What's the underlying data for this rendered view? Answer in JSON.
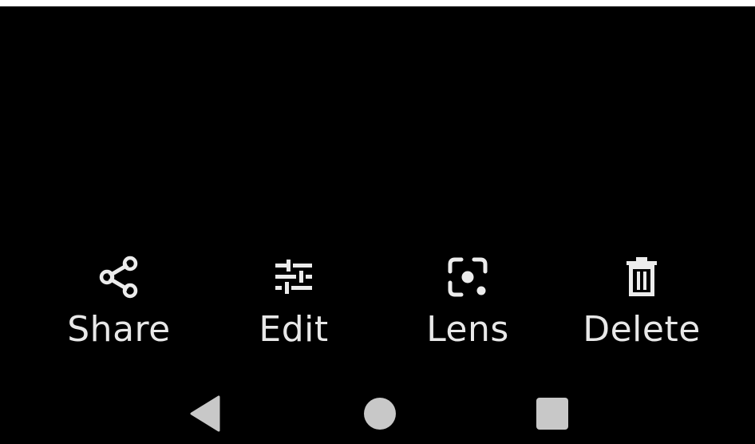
{
  "actions": {
    "share_label": "Share",
    "edit_label": "Edit",
    "lens_label": "Lens",
    "delete_label": "Delete"
  },
  "icons": {
    "share": "share-icon",
    "edit": "tune-sliders-icon",
    "lens": "google-lens-icon",
    "delete": "trash-icon",
    "back": "back-triangle-icon",
    "home": "home-circle-icon",
    "recents": "recents-square-icon"
  },
  "colors": {
    "background": "#000000",
    "action_foreground": "#e8e8e8",
    "nav_foreground": "#c8c8c8"
  }
}
